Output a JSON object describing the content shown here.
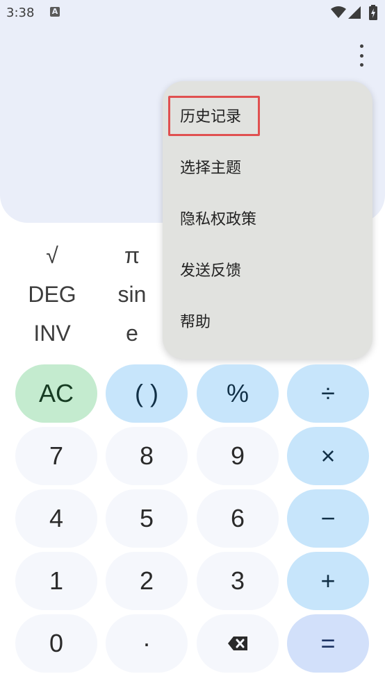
{
  "status_bar": {
    "time": "3:38",
    "notification_icon_letter": "A",
    "icons": [
      "wifi-icon",
      "signal-icon",
      "battery-charging-icon"
    ]
  },
  "toolbar": {
    "more_icon": "more-vert-icon"
  },
  "scientific": {
    "row1": [
      "√",
      "π"
    ],
    "row2": [
      "DEG",
      "sin"
    ],
    "row3": [
      "INV",
      "e"
    ]
  },
  "menu": {
    "items": [
      {
        "label": "历史记录",
        "highlighted": true
      },
      {
        "label": "选择主题"
      },
      {
        "label": "隐私权政策"
      },
      {
        "label": "发送反馈"
      },
      {
        "label": "帮助"
      }
    ],
    "highlight_color": "#e05050"
  },
  "keypad": {
    "ac": "AC",
    "parens": "( )",
    "percent": "%",
    "divide": "÷",
    "seven": "7",
    "eight": "8",
    "nine": "9",
    "multiply": "×",
    "four": "4",
    "five": "5",
    "six": "6",
    "minus": "−",
    "one": "1",
    "two": "2",
    "three": "3",
    "plus": "+",
    "zero": "0",
    "decimal": "·",
    "backspace_icon": "backspace-icon",
    "equals": "="
  },
  "colors": {
    "display_bg": "#eaeef9",
    "number_key": "#f5f7fc",
    "operator_key": "#c7e5fb",
    "ac_key": "#c4ebcf",
    "equals_key": "#d2e0fa",
    "menu_bg": "#e1e2df"
  }
}
